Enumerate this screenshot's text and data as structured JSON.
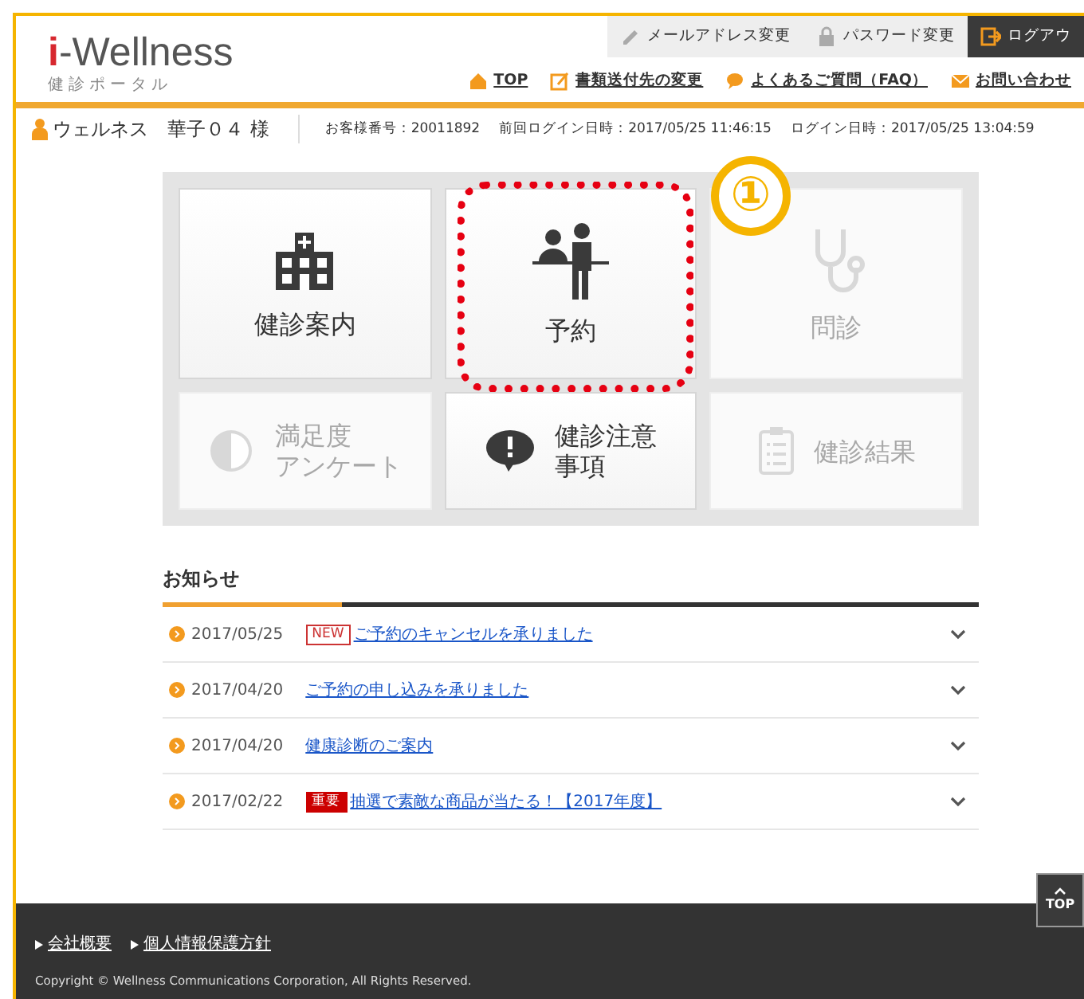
{
  "header": {
    "logo_prefix": "i",
    "logo_name": "-Wellness",
    "subtitle": "健診ポータル",
    "utility_links": [
      {
        "label": "メールアドレス変更",
        "kind": "plain"
      },
      {
        "label": "パスワード変更",
        "kind": "plain"
      },
      {
        "label": "ログアウ",
        "kind": "dark"
      }
    ],
    "nav": [
      "TOP",
      "書類送付先の変更",
      "よくあるご質問（FAQ）",
      "お問い合わせ"
    ]
  },
  "user_bar": {
    "name": "ウェルネス　華子０４ 様",
    "info": [
      "お客様番号：20011892",
      "前回ログイン日時：2017/05/25 11:46:15",
      "ログイン日時：2017/05/25 13:04:59"
    ]
  },
  "menu_tiles": [
    {
      "label": [
        "健診案内"
      ],
      "disabled": false,
      "highlighted": false
    },
    {
      "label": [
        "予約"
      ],
      "disabled": false,
      "highlighted": true
    },
    {
      "label": [
        "問診"
      ],
      "disabled": true,
      "highlighted": false
    },
    {
      "label": [
        "満足度",
        "アンケート"
      ],
      "disabled": true,
      "highlighted": false
    },
    {
      "label": [
        "健診注意",
        "事項"
      ],
      "disabled": false,
      "highlighted": false
    },
    {
      "label": [
        "健診結果"
      ],
      "disabled": true,
      "highlighted": false
    }
  ],
  "callout": "①",
  "news": {
    "title": "お知らせ",
    "items": [
      {
        "date": "2017/05/25",
        "badge": {
          "text": "NEW",
          "kind": "new"
        },
        "title": "ご予約のキャンセルを承りました",
        "expanded": false
      },
      {
        "date": "2017/04/20",
        "title": "ご予約の申し込みを承りました",
        "expanded": false
      },
      {
        "date": "2017/04/20",
        "title": "健康診断のご案内",
        "expanded": false
      },
      {
        "date": "2017/02/22",
        "badge": {
          "text": "重要",
          "kind": "important"
        },
        "title": "抽選で素敵な商品が当たる！【2017年度】",
        "expanded": false
      }
    ]
  },
  "back_to_top": "TOP",
  "footer": {
    "links": [
      "会社概要",
      "個人情報保護方針"
    ],
    "copyright": "Copyright © Wellness Communications Corporation, All Rights Reserved."
  }
}
